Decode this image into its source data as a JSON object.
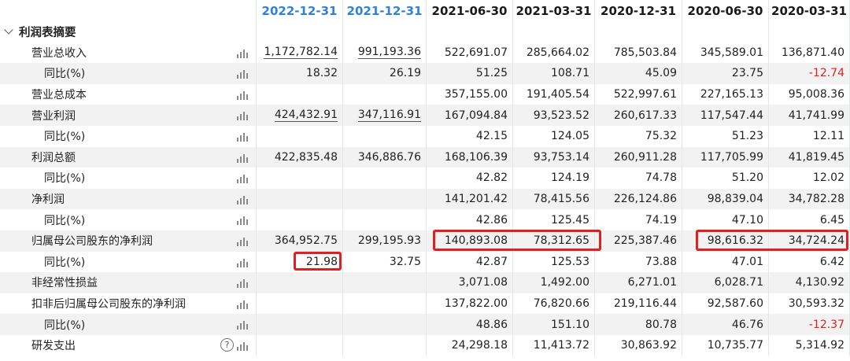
{
  "columns": [
    "2022-12-31",
    "2021-12-31",
    "2021-06-30",
    "2021-03-31",
    "2020-12-31",
    "2020-06-30",
    "2020-03-31"
  ],
  "section": {
    "label": "利润表摘要"
  },
  "rows": [
    {
      "label": "营业总收入",
      "level": 1,
      "values": [
        "1,172,782.14",
        "991,193.36",
        "522,691.07",
        "285,664.02",
        "785,503.84",
        "345,589.01",
        "136,871.40"
      ]
    },
    {
      "label": "同比(%)",
      "level": 2,
      "values": [
        "18.32",
        "26.19",
        "51.25",
        "108.71",
        "45.09",
        "23.75",
        "-12.74"
      ]
    },
    {
      "label": "营业总成本",
      "level": 1,
      "values": [
        "",
        "",
        "357,155.00",
        "191,405.54",
        "522,997.61",
        "227,165.13",
        "95,008.36"
      ]
    },
    {
      "label": "营业利润",
      "level": 1,
      "values": [
        "424,432.91",
        "347,116.91",
        "167,094.84",
        "93,523.52",
        "260,617.33",
        "117,547.44",
        "41,741.99"
      ]
    },
    {
      "label": "同比(%)",
      "level": 2,
      "values": [
        "",
        "",
        "42.15",
        "124.05",
        "75.32",
        "51.23",
        "12.11"
      ]
    },
    {
      "label": "利润总额",
      "level": 1,
      "values": [
        "422,835.48",
        "346,886.76",
        "168,106.39",
        "93,753.14",
        "260,911.28",
        "117,705.99",
        "41,819.45"
      ]
    },
    {
      "label": "同比(%)",
      "level": 2,
      "values": [
        "",
        "",
        "42.82",
        "124.19",
        "74.78",
        "51.20",
        "12.02"
      ]
    },
    {
      "label": "净利润",
      "level": 1,
      "values": [
        "",
        "",
        "141,201.42",
        "78,415.56",
        "226,124.86",
        "98,839.04",
        "34,782.28"
      ]
    },
    {
      "label": "同比(%)",
      "level": 2,
      "values": [
        "",
        "",
        "42.86",
        "125.45",
        "74.19",
        "47.10",
        "6.45"
      ]
    },
    {
      "label": "归属母公司股东的净利润",
      "level": 1,
      "values": [
        "364,952.75",
        "299,195.93",
        "140,893.08",
        "78,312.65",
        "225,387.46",
        "98,616.32",
        "34,724.24"
      ]
    },
    {
      "label": "同比(%)",
      "level": 2,
      "values": [
        "21.98",
        "32.75",
        "42.87",
        "125.53",
        "73.88",
        "47.01",
        "6.42"
      ]
    },
    {
      "label": "非经常性损益",
      "level": 1,
      "values": [
        "",
        "",
        "3,071.08",
        "1,492.00",
        "6,271.01",
        "6,028.71",
        "4,130.92"
      ]
    },
    {
      "label": "扣非后归属母公司股东的净利润",
      "level": 1,
      "values": [
        "",
        "",
        "137,822.00",
        "76,820.66",
        "219,116.44",
        "92,587.60",
        "30,593.32"
      ]
    },
    {
      "label": "同比(%)",
      "level": 2,
      "values": [
        "",
        "",
        "48.86",
        "151.10",
        "80.78",
        "46.76",
        "-12.37"
      ]
    },
    {
      "label": "研发支出",
      "level": 1,
      "values": [
        "",
        "",
        "24,298.18",
        "11,413.72",
        "30,863.92",
        "10,735.77",
        "5,314.92"
      ],
      "help": "?"
    }
  ],
  "icons": {
    "chart": "bar-chart-icon",
    "help": "help-icon",
    "collapse": "chevron-down-icon"
  },
  "colors": {
    "header_highlight": "#2f82d8",
    "negative": "#e02020",
    "annotation": "#e02020"
  }
}
